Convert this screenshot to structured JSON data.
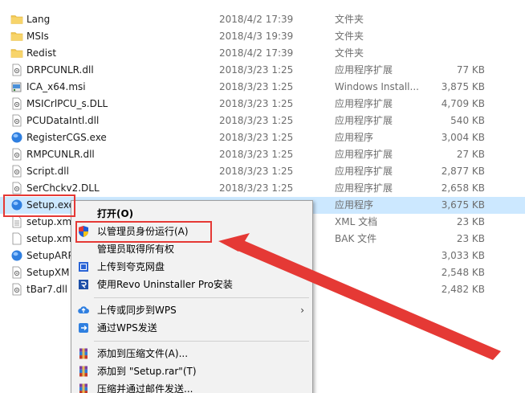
{
  "files": [
    {
      "name": "Lang",
      "date": "2018/4/2 17:39",
      "type": "文件夹",
      "size": "",
      "icon": "folder-icon"
    },
    {
      "name": "MSIs",
      "date": "2018/4/3 19:39",
      "type": "文件夹",
      "size": "",
      "icon": "folder-icon"
    },
    {
      "name": "Redist",
      "date": "2018/4/2 17:39",
      "type": "文件夹",
      "size": "",
      "icon": "folder-icon"
    },
    {
      "name": "DRPCUNLR.dll",
      "date": "2018/3/23 1:25",
      "type": "应用程序扩展",
      "size": "77 KB",
      "icon": "dll-icon"
    },
    {
      "name": "ICA_x64.msi",
      "date": "2018/3/23 1:25",
      "type": "Windows Install...",
      "size": "3,875 KB",
      "icon": "msi-icon"
    },
    {
      "name": "MSICrlPCU_s.DLL",
      "date": "2018/3/23 1:25",
      "type": "应用程序扩展",
      "size": "4,709 KB",
      "icon": "dll-icon"
    },
    {
      "name": "PCUDataIntl.dll",
      "date": "2018/3/23 1:25",
      "type": "应用程序扩展",
      "size": "540 KB",
      "icon": "dll-icon"
    },
    {
      "name": "RegisterCGS.exe",
      "date": "2018/3/23 1:25",
      "type": "应用程序",
      "size": "3,004 KB",
      "icon": "exe-icon"
    },
    {
      "name": "RMPCUNLR.dll",
      "date": "2018/3/23 1:25",
      "type": "应用程序扩展",
      "size": "27 KB",
      "icon": "dll-icon"
    },
    {
      "name": "Script.dll",
      "date": "2018/3/23 1:25",
      "type": "应用程序扩展",
      "size": "2,877 KB",
      "icon": "dll-icon"
    },
    {
      "name": "SerChckv2.DLL",
      "date": "2018/3/23 1:25",
      "type": "应用程序扩展",
      "size": "2,658 KB",
      "icon": "dll-icon"
    },
    {
      "name": "Setup.exe",
      "date": "",
      "type": "应用程序",
      "size": "3,675 KB",
      "icon": "exe-icon",
      "selected": true
    },
    {
      "name": "setup.xm",
      "date": "",
      "type": "XML 文档",
      "size": "23 KB",
      "icon": "xml-icon"
    },
    {
      "name": "setup.xm",
      "date": "",
      "type": "BAK 文件",
      "size": "23 KB",
      "icon": "bak-icon"
    },
    {
      "name": "SetupARP",
      "date": "",
      "type": "",
      "size": "3,033 KB",
      "icon": "exe-icon"
    },
    {
      "name": "SetupXM",
      "date": "",
      "type": "",
      "size": "2,548 KB",
      "icon": "dll-icon"
    },
    {
      "name": "tBar7.dll",
      "date": "",
      "type": "",
      "size": "2,482 KB",
      "icon": "dll-icon"
    }
  ],
  "context_menu": {
    "items": [
      {
        "label": "打开(O)",
        "bold": true,
        "icon": ""
      },
      {
        "label": "以管理员身份运行(A)",
        "icon": "uac-shield-icon"
      },
      {
        "label": "管理员取得所有权",
        "icon": ""
      },
      {
        "label": "上传到夸克网盘",
        "icon": "quark-cloud-icon"
      },
      {
        "label": "使用Revo Uninstaller Pro安装",
        "icon": "revo-uninstaller-icon"
      },
      {
        "label": "上传或同步到WPS",
        "icon": "wps-cloud-upload-icon",
        "submenu": true
      },
      {
        "label": "通过WPS发送",
        "icon": "wps-send-icon"
      },
      {
        "label": "添加到压缩文件(A)...",
        "icon": "winrar-icon"
      },
      {
        "label": "添加到 \"Setup.rar\"(T)",
        "icon": "winrar-icon"
      },
      {
        "label": "压缩并通过邮件发送...",
        "icon": "winrar-icon"
      }
    ],
    "submenu_arrow": "›"
  },
  "colors": {
    "selection": "#cce8ff",
    "annotation_red": "#e53935",
    "folder": "#f0c550",
    "uac_blue": "#1e5bd6",
    "uac_yellow": "#f5c518"
  }
}
